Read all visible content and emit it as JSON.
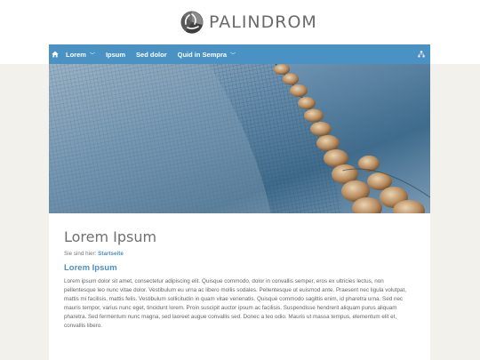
{
  "header": {
    "logo_text": "PALINDROM"
  },
  "nav": {
    "home_icon": "home-icon",
    "items": [
      {
        "label": "Lorem",
        "has_dropdown": true
      },
      {
        "label": "Ipsum",
        "has_dropdown": false
      },
      {
        "label": "Sed dolor",
        "has_dropdown": false
      },
      {
        "label": "Quid in Sempra",
        "has_dropdown": true
      }
    ],
    "right_icon": "sitemap-icon",
    "color": "#4a92c4"
  },
  "hero": {
    "image": "fishing-net-with-floats"
  },
  "content": {
    "title": "Lorem Ipsum",
    "breadcrumb_prefix": "Sie sind hier:",
    "breadcrumb_link": "Startseite",
    "section_title": "Lorem Ipsum",
    "body": "Lorem ipsum dolor sit amet, consectetur adipiscing elit. Quisque commodo, dolor in convallis semper, eros ex ultricies lectus, non pellentesque leo nunc vitae dolor. Vestibulum eu urna ac libero mollis sodales. Pellentesque ut euismod ante. Praesent nec ligula volutpat, mattis mi facilisis, mattis felis. Vestibulum sollicitudin in quam vitae venenatis. Quisque commodo sagittis enim, id pharetra urna. Sed nec mauris tempor, varius nunc eget, tincidunt lorem. Proin suscipit auctor ipsum ac facilisis. Suspendisse hendrerit aliquam purus aliquam pharetra. Sed fermentum nunc magna, sed laoreet augue convallis sed. Donec a leo odio. Mauris ut massa tempus, elementum elit et, convallis libero."
  }
}
